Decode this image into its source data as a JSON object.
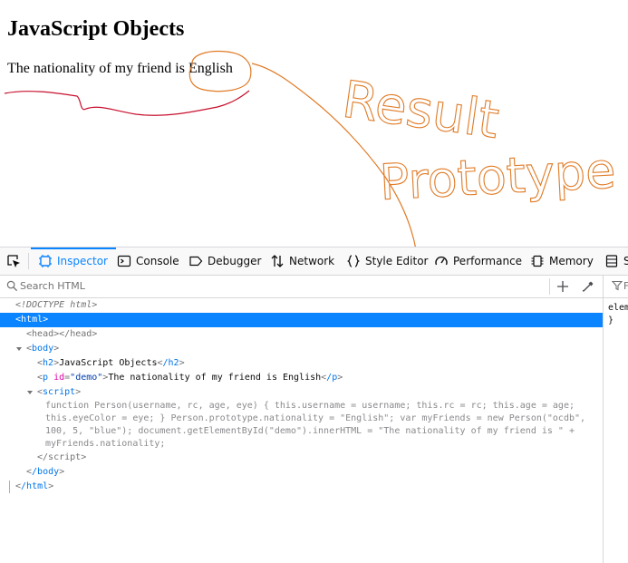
{
  "page": {
    "heading": "JavaScript Objects",
    "paragraph": "The nationality of my friend is English"
  },
  "annotations": {
    "text_line1": "Result",
    "text_line2": "Prototype",
    "pen_color": "#e07b26",
    "underline_color": "#c8102e"
  },
  "devtools": {
    "tabs": [
      {
        "label": "Inspector",
        "icon": "inspector-icon",
        "selected": true
      },
      {
        "label": "Console",
        "icon": "console-icon"
      },
      {
        "label": "Debugger",
        "icon": "debugger-icon"
      },
      {
        "label": "Network",
        "icon": "network-icon"
      },
      {
        "label": "Style Editor",
        "icon": "style-editor-icon"
      },
      {
        "label": "Performance",
        "icon": "performance-icon"
      },
      {
        "label": "Memory",
        "icon": "memory-icon"
      },
      {
        "label": "S",
        "icon": "storage-icon"
      }
    ],
    "search_placeholder": "Search HTML",
    "accent": "#0a84ff",
    "markup": {
      "doctype": "<!DOCTYPE html>",
      "html_open": "html",
      "head_open": "head",
      "head_close": "/head",
      "body_open": "body",
      "h2_open": "h2",
      "h2_text": "JavaScript Objects",
      "h2_close": "/h2",
      "p_open": "p",
      "p_attr_name": "id",
      "p_attr_value": "\"demo\"",
      "p_text": "The nationality of my friend is English",
      "p_close": "/p",
      "script_open": "script",
      "script_text": "function Person(username, rc, age, eye) { this.username = username; this.rc = rc; this.age = age; this.eyeColor = eye; } Person.prototype.nationality = \"English\"; var myFriends = new Person(\"ocdb\", 100, 5, \"blue\"); document.getElementById(\"demo\").innerHTML = \"The nationality of my friend is \" + myFriends.nationality;",
      "script_close": "/script",
      "body_close": "/body",
      "html_close": "/html"
    },
    "rules": {
      "filter_label": "F",
      "rule_text": "elem",
      "rule_close": "}"
    }
  }
}
